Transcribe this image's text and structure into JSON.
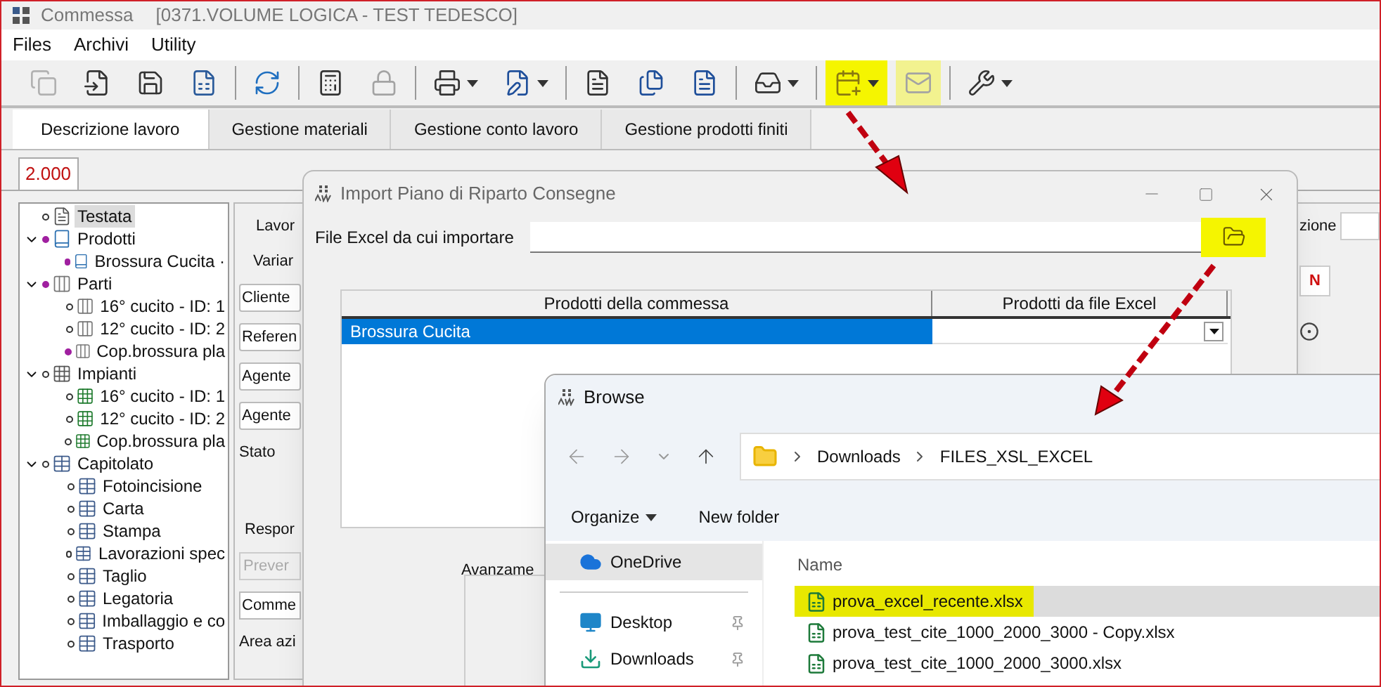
{
  "window": {
    "title": "Commessa",
    "subtitle": "[0371.VOLUME LOGICA - TEST TEDESCO]"
  },
  "menu": [
    "Files",
    "Archivi",
    "Utility"
  ],
  "toolbar": [
    [
      {
        "kind": "copy",
        "disabled": true,
        "dropdown": false,
        "highlighted": false
      },
      {
        "kind": "import",
        "disabled": false,
        "dropdown": false,
        "highlighted": false
      },
      {
        "kind": "save",
        "disabled": false,
        "dropdown": false,
        "highlighted": false
      },
      {
        "kind": "save-table",
        "disabled": false,
        "dropdown": false,
        "highlighted": false
      }
    ],
    [
      {
        "kind": "refresh",
        "disabled": false,
        "dropdown": false,
        "highlighted": false
      }
    ],
    [
      {
        "kind": "calculator",
        "disabled": false,
        "dropdown": false,
        "highlighted": false
      },
      {
        "kind": "lock",
        "disabled": true,
        "dropdown": false,
        "highlighted": false
      }
    ],
    [
      {
        "kind": "print",
        "disabled": false,
        "dropdown": true,
        "highlighted": false
      },
      {
        "kind": "form-edit",
        "disabled": false,
        "dropdown": true,
        "highlighted": false
      }
    ],
    [
      {
        "kind": "doc-a",
        "disabled": false,
        "dropdown": false,
        "highlighted": false
      },
      {
        "kind": "doc-copy",
        "disabled": false,
        "dropdown": false,
        "highlighted": false
      },
      {
        "kind": "doc-p",
        "disabled": false,
        "dropdown": false,
        "highlighted": false
      }
    ],
    [
      {
        "kind": "tray",
        "disabled": false,
        "dropdown": true,
        "highlighted": false
      }
    ],
    [
      {
        "kind": "calendar",
        "disabled": false,
        "dropdown": true,
        "highlighted": true
      },
      {
        "kind": "mail",
        "disabled": true,
        "dropdown": false,
        "highlighted": true
      }
    ],
    [
      {
        "kind": "wrench",
        "disabled": false,
        "dropdown": true,
        "highlighted": false
      }
    ]
  ],
  "tabs": [
    {
      "label": "Descrizione lavoro",
      "selected": true
    },
    {
      "label": "Gestione materiali",
      "selected": false
    },
    {
      "label": "Gestione conto lavoro",
      "selected": false
    },
    {
      "label": "Gestione prodotti finiti",
      "selected": false
    }
  ],
  "subtabs": [
    {
      "label": "2.000",
      "selected": true
    }
  ],
  "tree": [
    {
      "label": "Testata",
      "kind": "page",
      "marked": false,
      "selected": true
    },
    {
      "label": "Prodotti",
      "kind": "book",
      "marked": true,
      "selected": false,
      "expanded": true,
      "children": [
        {
          "label": "Brossura Cucita ·",
          "kind": "book",
          "marked": true,
          "selected": false
        }
      ]
    },
    {
      "label": "Parti",
      "kind": "part",
      "marked": true,
      "selected": false,
      "expanded": true,
      "children": [
        {
          "label": "16° cucito - ID: 1",
          "kind": "part",
          "marked": false,
          "selected": false
        },
        {
          "label": "12° cucito - ID: 2",
          "kind": "part",
          "marked": false,
          "selected": false
        },
        {
          "label": "Cop.brossura pla",
          "kind": "part",
          "marked": true,
          "selected": false
        }
      ]
    },
    {
      "label": "Impianti",
      "kind": "plant",
      "marked": false,
      "selected": false,
      "expanded": true,
      "children": [
        {
          "label": "16° cucito - ID: 1",
          "kind": "plate",
          "marked": false,
          "selected": false
        },
        {
          "label": "12° cucito - ID: 2",
          "kind": "plate",
          "marked": false,
          "selected": false
        },
        {
          "label": "Cop.brossura pla",
          "kind": "plate",
          "marked": false,
          "selected": false
        }
      ]
    },
    {
      "label": "Capitolato",
      "kind": "grid",
      "marked": false,
      "selected": false,
      "expanded": true,
      "children": [
        {
          "label": "Fotoincisione",
          "kind": "grid",
          "marked": false,
          "selected": false
        },
        {
          "label": "Carta",
          "kind": "grid",
          "marked": false,
          "selected": false
        },
        {
          "label": "Stampa",
          "kind": "grid",
          "marked": false,
          "selected": false
        },
        {
          "label": "Lavorazioni spec",
          "kind": "grid",
          "marked": false,
          "selected": false
        },
        {
          "label": "Taglio",
          "kind": "grid",
          "marked": false,
          "selected": false
        },
        {
          "label": "Legatoria",
          "kind": "grid",
          "marked": false,
          "selected": false
        },
        {
          "label": "Imballaggio e co",
          "kind": "grid",
          "marked": false,
          "selected": false
        },
        {
          "label": "Trasporto",
          "kind": "grid",
          "marked": false,
          "selected": false
        }
      ]
    }
  ],
  "form": {
    "label_1": "Lavor",
    "label_2": "Variar",
    "buttons": [
      "Cliente",
      "Referen",
      "Agente",
      "Agente"
    ],
    "stato": "Stato",
    "group": "Respor",
    "disabled_button": "Prever",
    "button_2": "Comme",
    "area": "Area azi",
    "right_label": "zione",
    "right_button": "N"
  },
  "import_dialog": {
    "title": "Import Piano di Riparto Consegne",
    "file_label": "File Excel da cui importare",
    "browse_highlighted": true,
    "columns": [
      "Prodotti della commessa",
      "Prodotti da file Excel"
    ],
    "rows": [
      {
        "product": "Brossura Cucita",
        "selected": true
      }
    ],
    "group_label": "Avanzame"
  },
  "browse_dialog": {
    "title": "Browse",
    "path": [
      "Downloads",
      "FILES_XSL_EXCEL"
    ],
    "commands": [
      {
        "label": "Organize",
        "dropdown": true
      },
      {
        "label": "New folder",
        "dropdown": false
      }
    ],
    "nav": [
      {
        "label": "OneDrive",
        "kind": "cloud",
        "selected": true,
        "pinned": false
      },
      {
        "label": "Desktop",
        "kind": "desktop",
        "selected": false,
        "pinned": true
      },
      {
        "label": "Downloads",
        "kind": "download",
        "selected": false,
        "pinned": true
      }
    ],
    "column": "Name",
    "files": [
      {
        "name": "prova_excel_recente.xlsx",
        "selected": true,
        "highlighted": true
      },
      {
        "name": "prova_test_cite_1000_2000_3000 - Copy.xlsx",
        "selected": false,
        "highlighted": false
      },
      {
        "name": "prova_test_cite_1000_2000_3000.xlsx",
        "selected": false,
        "highlighted": false
      }
    ]
  }
}
